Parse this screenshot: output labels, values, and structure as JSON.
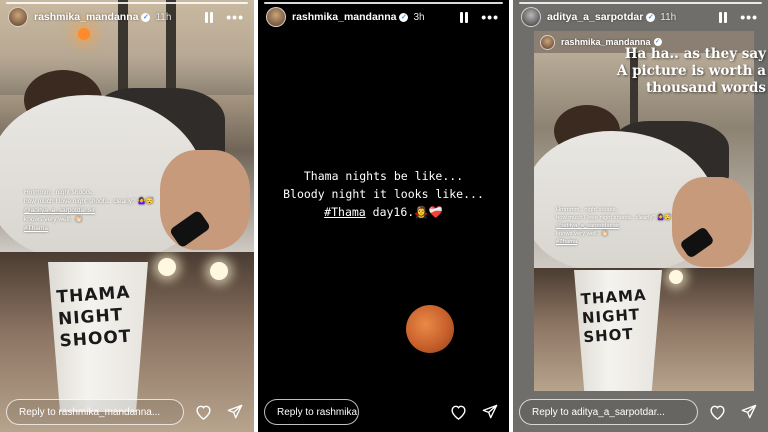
{
  "stories": [
    {
      "username": "rashmika_mandanna",
      "verified": true,
      "time": "11h",
      "caption_lines": [
        "Hmmmm.. night shoots..",
        "how much I love night shoots.. clearly? 🤷‍♀️😴",
        "@aditya_a_sarpotdar sir",
        "knows very well.. 👏🏻",
        "#Thama"
      ],
      "cup_text": [
        "THAMA",
        "NIGHT",
        "SHOOT"
      ],
      "reply_placeholder": "Reply to rashmika_mandanna..."
    },
    {
      "username": "rashmika_mandanna",
      "verified": true,
      "time": "3h",
      "text_line1": "Thama nights be like...",
      "text_line2": "Bloody night it looks like...",
      "hashtag": "#Thama",
      "text_line3_rest": " day16.🧛‍♀️❤️‍🩹",
      "reply_placeholder": "Reply to rashmika_mandanna..."
    },
    {
      "username": "aditya_a_sarpotdar",
      "verified": true,
      "time": "11h",
      "embedded_username": "rashmika_mandanna",
      "overlay_lines": [
        "Ha ha.. as they say",
        "A picture is worth a",
        "thousand words"
      ],
      "caption_lines": [
        "Hmmmm.. night shoots..",
        "how much I love night shoots.. clearly? 🤷‍♀️😴",
        "@aditya_a_sarpotdar sir",
        "knows very well.. 👏🏻",
        "#Thama"
      ],
      "cup_text": [
        "THAMA",
        "NIGHT",
        "SHOT"
      ],
      "reply_placeholder": "Reply to aditya_a_sarpotdar..."
    }
  ],
  "icons": {
    "like": "heart-icon",
    "share": "send-icon",
    "pause": "pause-icon",
    "more": "more-icon",
    "verified": "verified-badge-icon"
  },
  "colors": {
    "verified_blue": "#3897f0",
    "moon_orange": "#d0692f",
    "story2_background": "#000000"
  }
}
